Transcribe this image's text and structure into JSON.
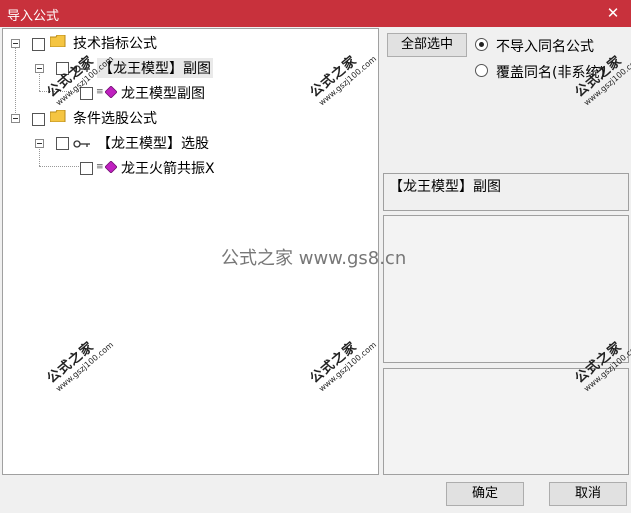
{
  "window": {
    "title": "导入公式",
    "close_glyph": "✕"
  },
  "tree": {
    "nodes": [
      {
        "label": "技术指标公式"
      },
      {
        "label": "【龙王模型】副图"
      },
      {
        "label": "龙王模型副图"
      },
      {
        "label": "条件选股公式"
      },
      {
        "label": "【龙王模型】选股"
      },
      {
        "label": "龙王火箭共振X"
      }
    ]
  },
  "actions": {
    "select_all": "全部选中"
  },
  "options": [
    {
      "label": "不导入同名公式",
      "selected": true
    },
    {
      "label": "覆盖同名(非系统)",
      "selected": false
    }
  ],
  "info": {
    "selected_formula": "【龙王模型】副图"
  },
  "watermark": {
    "center": "公式之家 www.gs8.cn",
    "stamp": "公式之家",
    "stamp_url": "www.gszj100.com"
  },
  "footer": {
    "ok": "确定",
    "cancel": "取消"
  },
  "colors": {
    "titlebar": "#c8313c",
    "gem": "#c020c0",
    "folder": "#f5c542"
  }
}
